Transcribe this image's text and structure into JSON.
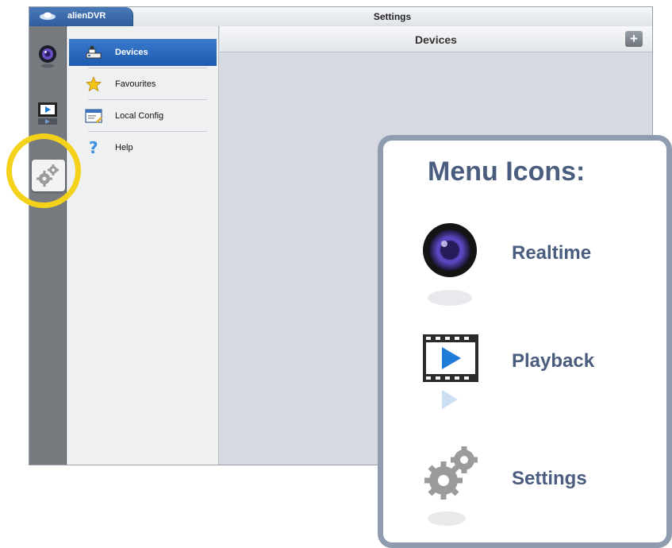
{
  "app": {
    "brand": "alienDVR",
    "window_title": "Settings"
  },
  "rail": {
    "items": [
      {
        "icon": "realtime-camera-icon"
      },
      {
        "icon": "playback-film-icon"
      },
      {
        "icon": "settings-gears-icon",
        "selected": true
      }
    ]
  },
  "sidebar": {
    "items": [
      {
        "label": "Devices",
        "icon": "devices-icon",
        "active": true
      },
      {
        "label": "Favourites",
        "icon": "star-icon"
      },
      {
        "label": "Local Config",
        "icon": "local-config-icon"
      },
      {
        "label": "Help",
        "icon": "help-icon"
      }
    ]
  },
  "main": {
    "header_title": "Devices",
    "add_button": "+"
  },
  "callout": {
    "title": "Menu Icons:",
    "items": [
      {
        "label": "Realtime",
        "icon": "realtime-camera-icon"
      },
      {
        "label": "Playback",
        "icon": "playback-film-icon"
      },
      {
        "label": "Settings",
        "icon": "settings-gears-icon"
      }
    ]
  },
  "colors": {
    "accent_blue": "#2a67bd",
    "highlight_yellow": "#f4d21a",
    "callout_text": "#4a5d7e",
    "callout_border": "#8f9cb0"
  }
}
